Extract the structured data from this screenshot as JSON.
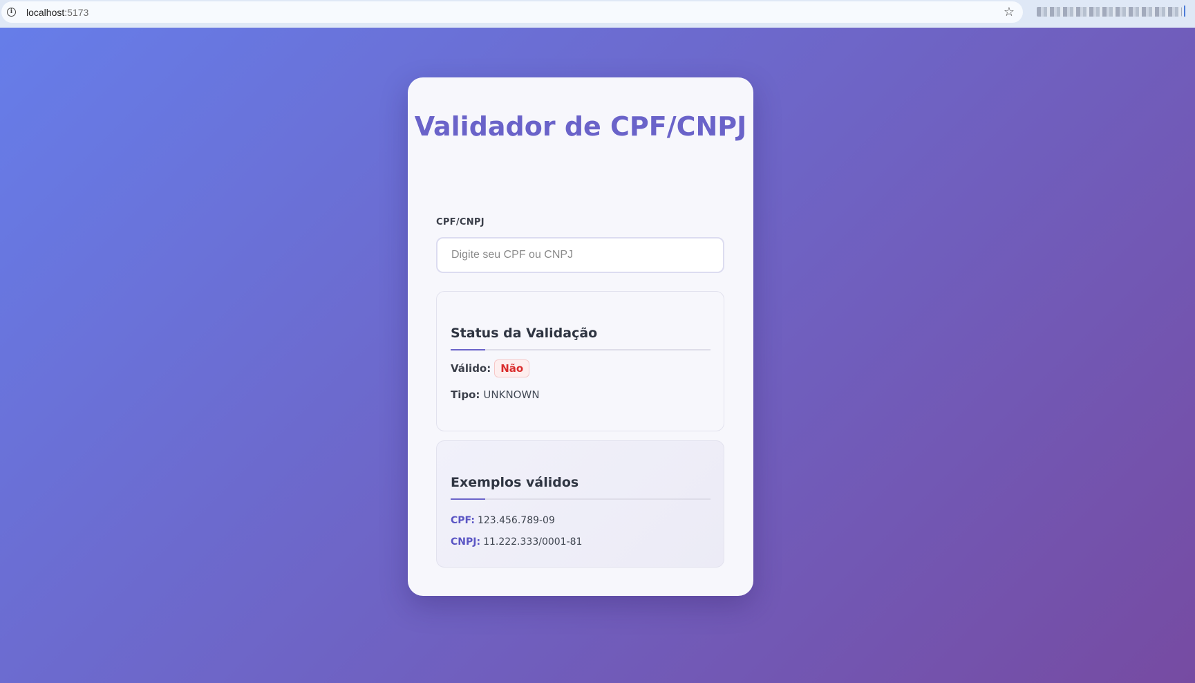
{
  "browser": {
    "url_host": "localhost",
    "url_port": ":5173",
    "info_icon": "info-icon",
    "bookmark_icon": "star-icon"
  },
  "card": {
    "title": "Validador de CPF/CNPJ",
    "input_label": "CPF/CNPJ",
    "input_placeholder": "Digite seu CPF ou CNPJ",
    "input_value": ""
  },
  "status": {
    "title": "Status da Validação",
    "valid_label": "Válido:",
    "valid_value": "Não",
    "type_label": "Tipo:",
    "type_value": "UNKNOWN"
  },
  "examples": {
    "title": "Exemplos válidos",
    "cpf_label": "CPF:",
    "cpf_value": "123.456.789-09",
    "cnpj_label": "CNPJ:",
    "cnpj_value": "11.222.333/0001-81"
  },
  "colors": {
    "background_start": "#667eea",
    "background_end": "#764ba2",
    "accent": "#6a63c9",
    "invalid": "#d92b2b"
  }
}
